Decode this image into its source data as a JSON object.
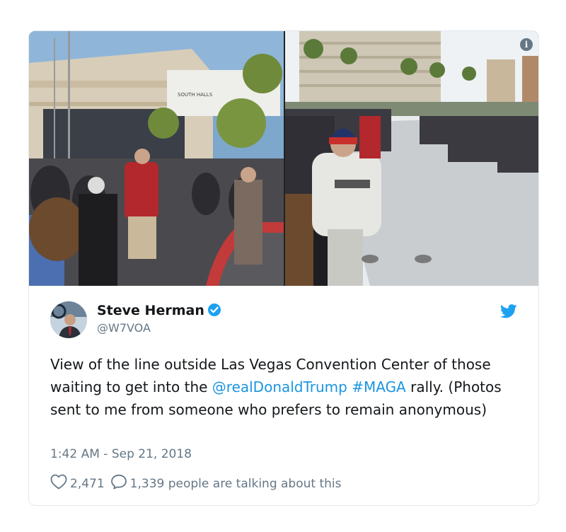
{
  "author": {
    "display_name": "Steve Herman",
    "handle": "@W7VOA",
    "verified": true
  },
  "tweet": {
    "text_before": "View of the line outside Las Vegas Convention Center of those waiting to get into the ",
    "mention": "@realDonaldTrump",
    "hashtag": "#MAGA",
    "text_after": " rally. (Photos sent to me from someone who prefers to remain anonymous)",
    "timestamp": "1:42 AM - Sep 21, 2018"
  },
  "stats": {
    "likes": "2,471",
    "replies": "1,339 people are talking about this"
  },
  "photo_left": {
    "sign_text": "SOUTH HALLS"
  },
  "colors": {
    "link": "#1b95e0",
    "verified": "#1da1f2",
    "muted": "#657786",
    "border": "#e1e8ed"
  },
  "icons": [
    "info-icon",
    "verified-badge-icon",
    "twitter-bird-icon",
    "heart-icon",
    "reply-bubble-icon"
  ]
}
